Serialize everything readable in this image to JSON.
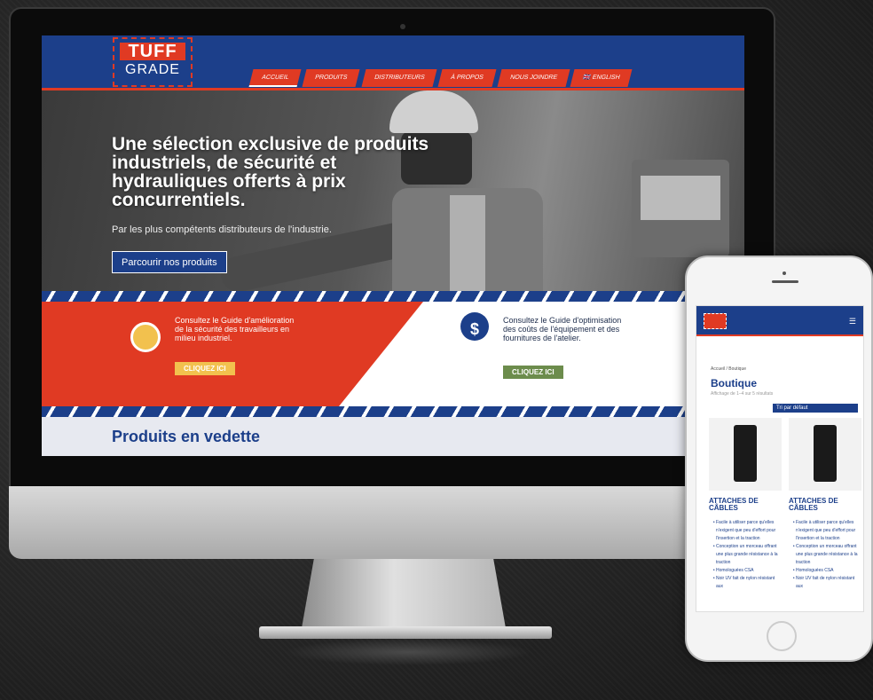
{
  "header": {
    "logo_line1": "TUFF",
    "logo_line2": "GRADE",
    "nav": [
      "ACCUEIL",
      "PRODUITS",
      "DISTRIBUTEURS",
      "À PROPOS",
      "NOUS JOINDRE",
      "🇬🇧 ENGLISH"
    ]
  },
  "hero": {
    "headline": "Une sélection exclusive de produits industriels, de sécurité et hydrauliques offerts à prix concurrentiels.",
    "subline": "Par les plus compétents distributeurs de l'industrie.",
    "cta": "Parcourir nos produits"
  },
  "guides": [
    {
      "text": "Consultez le Guide d'amélioration de la sécurité des travailleurs en milieu industriel.",
      "button": "CLIQUEZ ICI",
      "color": "#f2c14e"
    },
    {
      "text": "Consultez le Guide d'optimisation des coûts de l'équipement et des fournitures de l'atelier.",
      "button": "CLIQUEZ ICI",
      "color": "#6c8c4c"
    }
  ],
  "featured": {
    "title": "Produits en vedette"
  },
  "mobile": {
    "breadcrumb": "Accueil / Boutique",
    "title": "Boutique",
    "results": "Affichage de 1–4 sur 5 résultats",
    "sort": "Tri par défaut",
    "products": [
      {
        "name": "ATTACHES DE CÂBLES",
        "bullets": [
          "Facile à utiliser parce qu'elles n'exigent que peu d'effort pour l'insertion et la traction",
          "Conception un morceau offrant une plus grande résistance à la traction",
          "Homologuées CSA",
          "Noir UV fait de nylon résistant aux"
        ]
      },
      {
        "name": "ATTACHES DE CÂBLES",
        "bullets": [
          "Facile à utiliser parce qu'elles n'exigent que peu d'effort pour l'insertion et la traction",
          "Conception un morceau offrant une plus grande résistance à la traction",
          "Homologuées CSA",
          "Noir UV fait de nylon résistant aux"
        ]
      }
    ]
  },
  "colors": {
    "brand_blue": "#1c3f8a",
    "brand_red": "#e03a23"
  }
}
